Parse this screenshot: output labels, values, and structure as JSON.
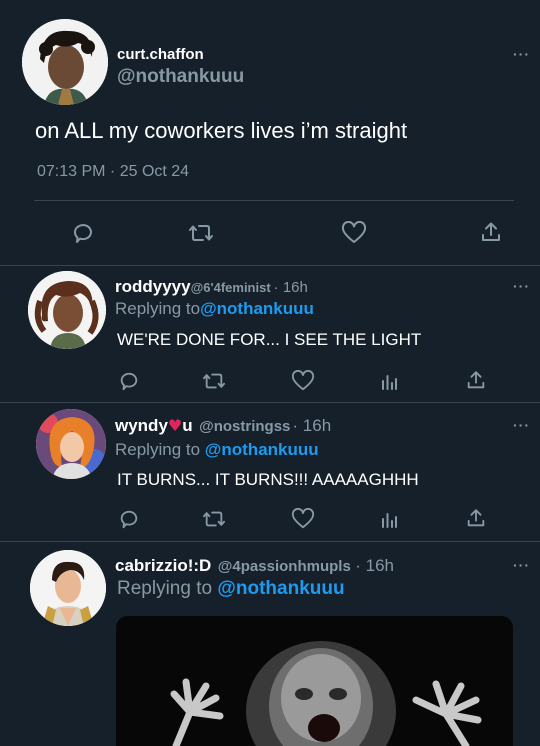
{
  "main_tweet": {
    "display_name": "curt.chaffon",
    "handle": "@nothankuuu",
    "text": "on ALL my coworkers lives i’m straight",
    "timestamp": "07:13 PM · 25 Oct 24",
    "more_label": "···"
  },
  "replies": [
    {
      "display_name": "roddyyyy",
      "handle": "@6'4feminist",
      "time": "· 16h",
      "replying_prefix": "Replying to",
      "replying_handle": "@nothankuuu",
      "text": "WE'RE DONE FOR... I SEE THE LIGHT",
      "more_label": "···"
    },
    {
      "display_name": "wyndy",
      "name_suffix": "u",
      "handle": "@nostringss",
      "time": "· 16h",
      "replying_prefix": "Replying to",
      "replying_handle": "@nothankuuu",
      "text": "IT BURNS... IT BURNS!!! AAAAAGHHH",
      "more_label": "···"
    },
    {
      "display_name": "cabrizzio!:D",
      "handle": "@4passionhmupls",
      "time": "· 16h",
      "replying_prefix": "Replying to",
      "replying_handle": "@nothankuuu",
      "more_label": "···"
    }
  ],
  "icons": [
    "reply-icon",
    "retweet-icon",
    "like-icon",
    "share-icon",
    "analytics-icon",
    "heart-emoji-icon",
    "more-icon"
  ],
  "colors": {
    "background": "#15202b",
    "text": "#ffffff",
    "muted": "#8899a6",
    "link": "#1d9bf0",
    "divider": "#38444d",
    "heart_emoji": "#e0245e"
  }
}
